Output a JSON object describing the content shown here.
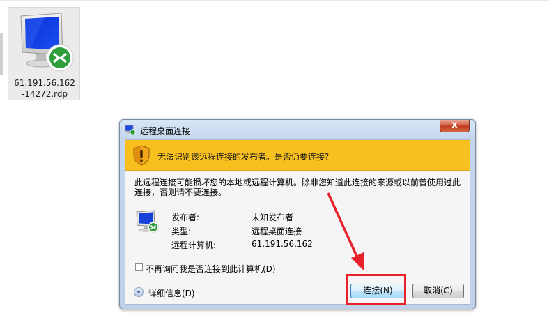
{
  "desktop": {
    "file_icon": {
      "icon": "remote-desktop-file-icon",
      "label": "61.191.56.162-14272.rdp"
    }
  },
  "dialog": {
    "title": "远程桌面连接",
    "title_icon": "remote-desktop-icon",
    "close_label": "x",
    "warning": {
      "icon": "shield-warning-icon",
      "text": "无法识别该远程连接的发布者。是否仍要连接?"
    },
    "body_text": "此远程连接可能损坏您的本地或远程计算机。除非您知道此连接的来源或以前曾使用过此连接，否则请不要连接。",
    "info_icon": "remote-desktop-icon",
    "info": [
      {
        "key": "发布者:",
        "value": "未知发布者"
      },
      {
        "key": "类型:",
        "value": "远程桌面连接"
      },
      {
        "key": "远程计算机:",
        "value": "61.191.56.162"
      }
    ],
    "checkbox_label": "不再询问我是否连接到此计算机(D)",
    "checkbox_checked": false,
    "details_label": "详细信息(D)",
    "connect_label": "连接(N)",
    "cancel_label": "取消(C)"
  },
  "colors": {
    "warning_band": "#f8c01f",
    "annotation_red": "#e8222a"
  }
}
